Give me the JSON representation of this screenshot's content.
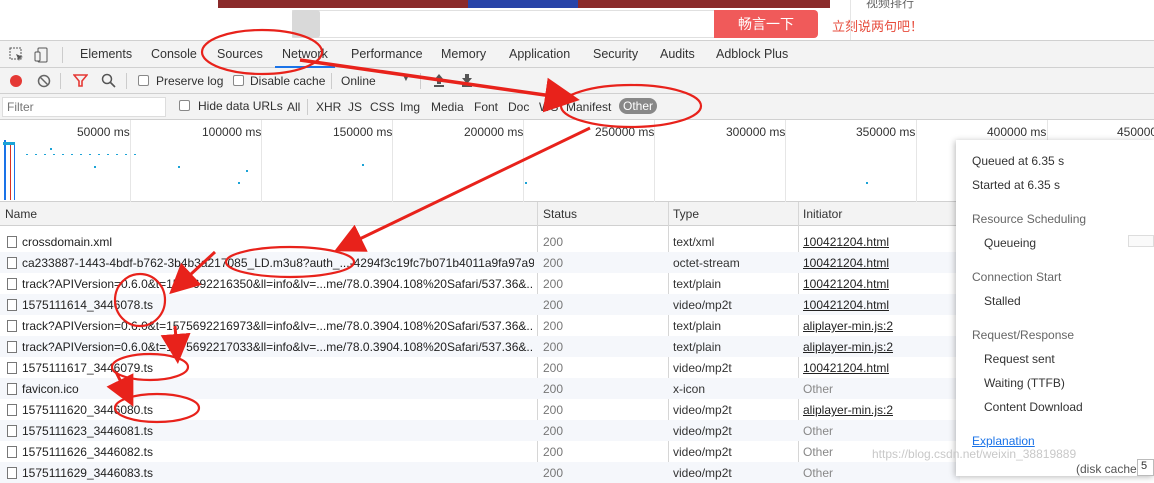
{
  "webpage": {
    "search_button": "畅言一下",
    "slogan": "立刻说两句吧！",
    "side_text": "视频排行"
  },
  "devtools": {
    "tabs": [
      "Elements",
      "Console",
      "Sources",
      "Network",
      "Performance",
      "Memory",
      "Application",
      "Security",
      "Audits",
      "Adblock Plus"
    ],
    "active_tab": "Network",
    "toolbar": {
      "preserve_log": "Preserve log",
      "disable_cache": "Disable cache",
      "throttle": "Online"
    },
    "filterbar": {
      "placeholder": "Filter",
      "hide_data_urls": "Hide data URLs",
      "types": [
        "All",
        "XHR",
        "JS",
        "CSS",
        "Img",
        "Media",
        "Font",
        "Doc",
        "WS",
        "Manifest",
        "Other"
      ],
      "selected_type": "Other"
    },
    "overview_ticks": [
      "50000 ms",
      "100000 ms",
      "150000 ms",
      "200000 ms",
      "250000 ms",
      "300000 ms",
      "350000 ms",
      "400000 ms",
      "450000"
    ],
    "columns": [
      "Name",
      "Status",
      "Type",
      "Initiator"
    ],
    "rows": [
      {
        "name": "crossdomain.xml",
        "status": "200",
        "type": "text/xml",
        "initiator": "100421204.html",
        "link": true
      },
      {
        "name": "ca233887-1443-4bdf-b762-3b4b3a217085_LD.m3u8?auth_...-4294f3c19fc7b071b4011a9fa97a9...",
        "status": "200",
        "type": "octet-stream",
        "initiator": "100421204.html",
        "link": true
      },
      {
        "name": "track?APIVersion=0.6.0&t=1575692216350&ll=info&lv=...me/78.0.3904.108%20Safari/537.36&...",
        "status": "200",
        "type": "text/plain",
        "initiator": "100421204.html",
        "link": true
      },
      {
        "name": "1575111614_3446078.ts",
        "status": "200",
        "type": "video/mp2t",
        "initiator": "100421204.html",
        "link": true
      },
      {
        "name": "track?APIVersion=0.6.0&t=1575692216973&ll=info&lv=...me/78.0.3904.108%20Safari/537.36&...",
        "status": "200",
        "type": "text/plain",
        "initiator": "aliplayer-min.js:2",
        "link": true
      },
      {
        "name": "track?APIVersion=0.6.0&t=1575692217033&ll=info&lv=...me/78.0.3904.108%20Safari/537.36&...",
        "status": "200",
        "type": "text/plain",
        "initiator": "aliplayer-min.js:2",
        "link": true
      },
      {
        "name": "1575111617_3446079.ts",
        "status": "200",
        "type": "video/mp2t",
        "initiator": "100421204.html",
        "link": true
      },
      {
        "name": "favicon.ico",
        "status": "200",
        "type": "x-icon",
        "initiator": "Other",
        "link": false
      },
      {
        "name": "1575111620_3446080.ts",
        "status": "200",
        "type": "video/mp2t",
        "initiator": "aliplayer-min.js:2",
        "link": true
      },
      {
        "name": "1575111623_3446081.ts",
        "status": "200",
        "type": "video/mp2t",
        "initiator": "Other",
        "link": false
      },
      {
        "name": "1575111626_3446082.ts",
        "status": "200",
        "type": "video/mp2t",
        "initiator": "Other",
        "link": false
      },
      {
        "name": "1575111629_3446083.ts",
        "status": "200",
        "type": "video/mp2t",
        "initiator": "Other",
        "link": false
      }
    ],
    "timing": {
      "queued": "Queued at 6.35 s",
      "started": "Started at 6.35 s",
      "resource_scheduling": "Resource Scheduling",
      "queueing": "Queueing",
      "connection_start": "Connection Start",
      "stalled": "Stalled",
      "request_response": "Request/Response",
      "request_sent": "Request sent",
      "waiting": "Waiting (TTFB)",
      "content_download": "Content Download",
      "explanation": "Explanation"
    },
    "disk_cache": "(disk cache)",
    "right_edge": "5",
    "watermark": "https://blog.csdn.net/weixin_38819889"
  },
  "colors": {
    "accent_blue": "#1a73e8",
    "annotation_red": "#e8221b",
    "search_button": "#f05a5a"
  }
}
